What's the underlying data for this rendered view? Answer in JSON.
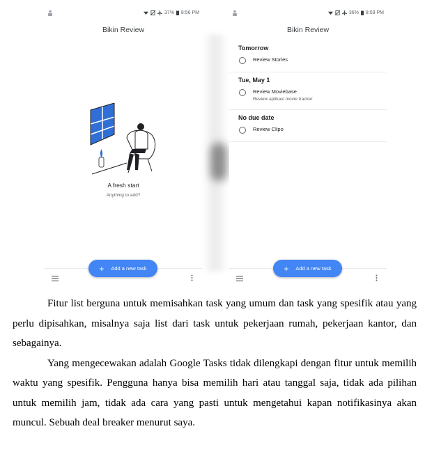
{
  "left_phone": {
    "status": {
      "battery": "37%",
      "time": "8:56 PM"
    },
    "app_title": "Bikin Review",
    "empty_state": {
      "title": "A fresh start",
      "subtitle": "Anything to add?"
    },
    "fab_label": "Add a new task"
  },
  "right_phone": {
    "status": {
      "battery": "36%",
      "time": "8:59 PM"
    },
    "app_title": "Bikin Review",
    "sections": [
      {
        "header": "Tomorrow",
        "tasks": [
          {
            "title": "Review Stories",
            "note": ""
          }
        ]
      },
      {
        "header": "Tue, May 1",
        "tasks": [
          {
            "title": "Review Moviebase",
            "note": "Review aplikasi movie tracker"
          }
        ]
      },
      {
        "header": "No due date",
        "tasks": [
          {
            "title": "Review Clipo",
            "note": ""
          }
        ]
      }
    ],
    "fab_label": "Add a new task"
  },
  "article": {
    "paragraphs": [
      "Fitur list berguna untuk memisahkan task yang umum dan task yang spesifik atau yang perlu dipisahkan, misalnya saja list dari task untuk pekerjaan rumah, pekerjaan kantor, dan sebagainya.",
      "Yang mengecewakan adalah Google Tasks tidak dilengkapi dengan fitur untuk memilih waktu yang spesifik. Pengguna hanya bisa memilih hari atau tanggal saja, tidak ada pilihan untuk memilih jam, tidak ada cara yang pasti untuk mengetahui kapan notifikasinya akan muncul. Sebuah deal breaker menurut saya."
    ]
  },
  "colors": {
    "accent": "#4285f4",
    "illustration_blue": "#2f6fd6"
  },
  "icons": [
    "person-icon",
    "wifi-icon",
    "no-sim-icon",
    "airplane-icon",
    "battery-icon",
    "menu-icon",
    "more-vert-icon",
    "plus-icon"
  ]
}
